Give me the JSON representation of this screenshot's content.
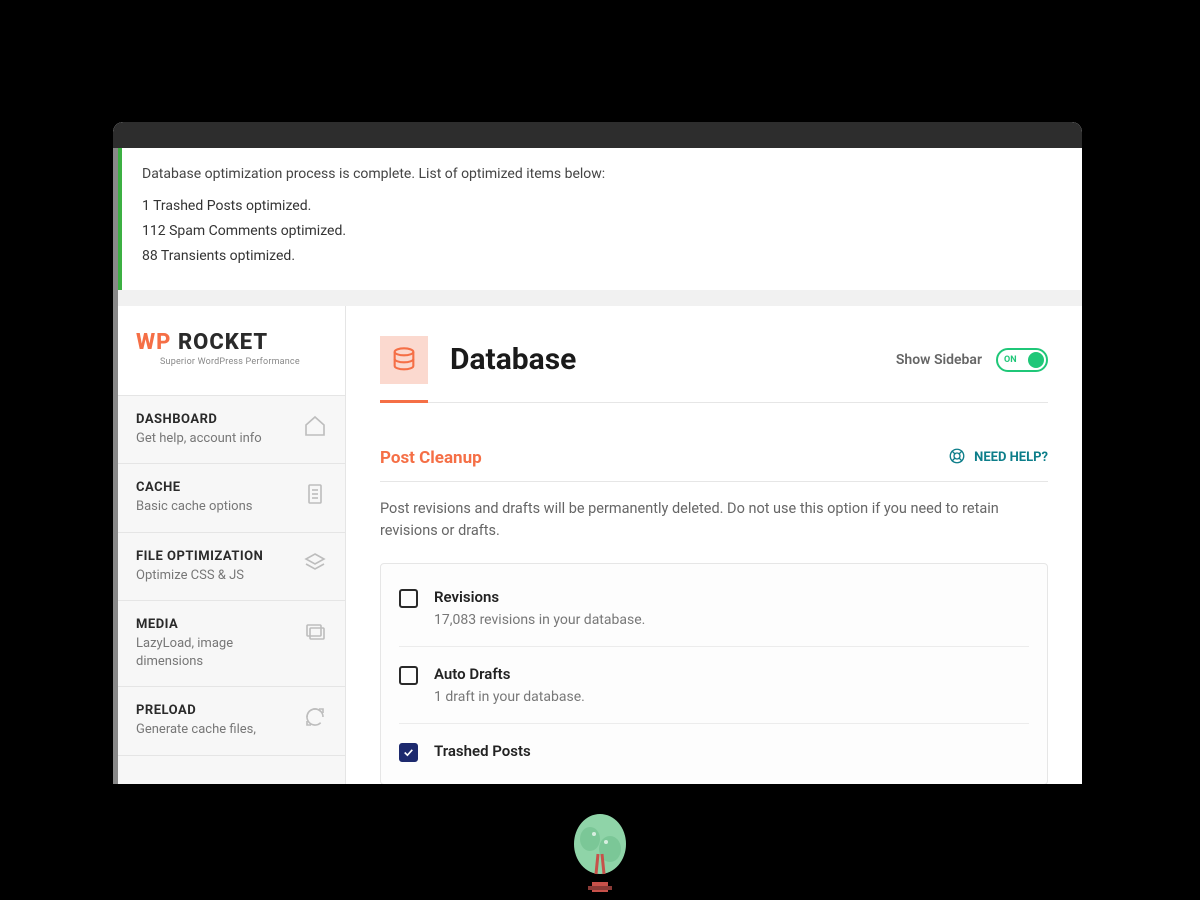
{
  "notice": {
    "heading": "Database optimization process is complete. List of optimized items below:",
    "items": [
      "1 Trashed Posts optimized.",
      "112 Spam Comments optimized.",
      "88 Transients optimized."
    ]
  },
  "logo": {
    "wp": "WP",
    "rocket": "ROCKET",
    "tagline": "Superior WordPress Performance"
  },
  "nav": [
    {
      "title": "DASHBOARD",
      "sub": "Get help, account info",
      "icon": "home"
    },
    {
      "title": "CACHE",
      "sub": "Basic cache options",
      "icon": "doc"
    },
    {
      "title": "FILE OPTIMIZATION",
      "sub": "Optimize CSS & JS",
      "icon": "layers"
    },
    {
      "title": "MEDIA",
      "sub": "LazyLoad, image dimensions",
      "icon": "images"
    },
    {
      "title": "PRELOAD",
      "sub": "Generate cache files,",
      "icon": "refresh"
    }
  ],
  "page": {
    "title": "Database",
    "show_sidebar": "Show Sidebar",
    "toggle": "ON"
  },
  "section": {
    "title": "Post Cleanup",
    "help": "NEED HELP?",
    "desc": "Post revisions and drafts will be permanently deleted. Do not use this option if you need to retain revisions or drafts."
  },
  "options": [
    {
      "label": "Revisions",
      "sub": "17,083 revisions in your database.",
      "checked": false
    },
    {
      "label": "Auto Drafts",
      "sub": "1 draft in your database.",
      "checked": false
    },
    {
      "label": "Trashed Posts",
      "sub": "",
      "checked": true
    }
  ]
}
